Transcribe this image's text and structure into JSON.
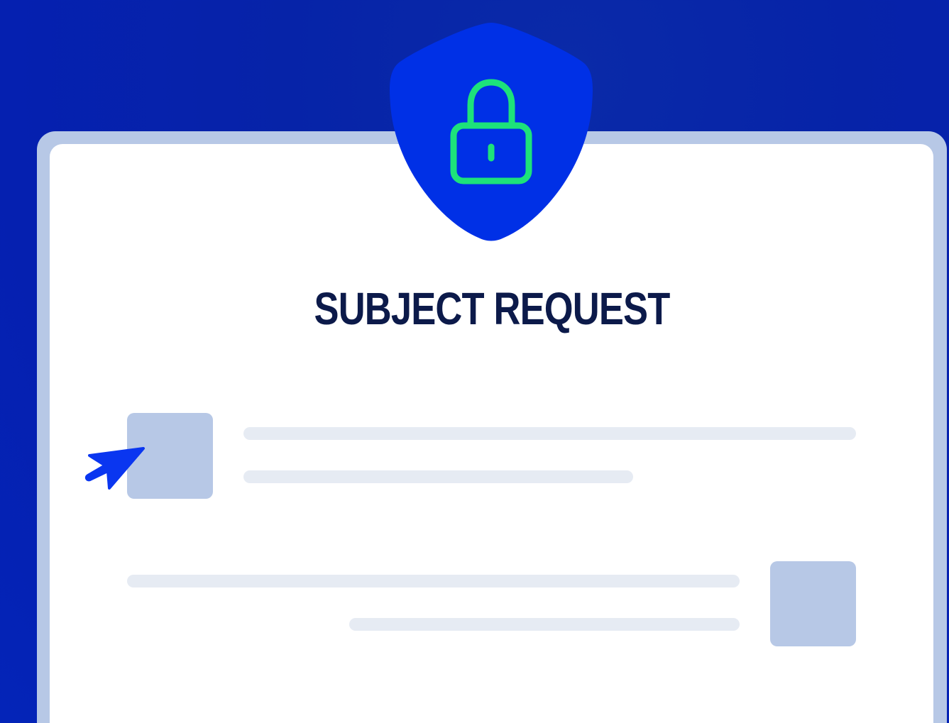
{
  "card": {
    "title": "SUBJECT REQUEST"
  },
  "icons": {
    "shield": "shield-icon",
    "lock": "lock-icon",
    "cursor": "cursor-arrow-icon"
  },
  "colors": {
    "background": "#0623a8",
    "shield": "#0030e6",
    "lock": "#1de27a",
    "card_frame": "#b7c8e6",
    "title": "#0c1a4a",
    "placeholder_square": "#b7c8e6",
    "placeholder_line": "#e6ebf3",
    "cursor": "#0a36f0"
  }
}
